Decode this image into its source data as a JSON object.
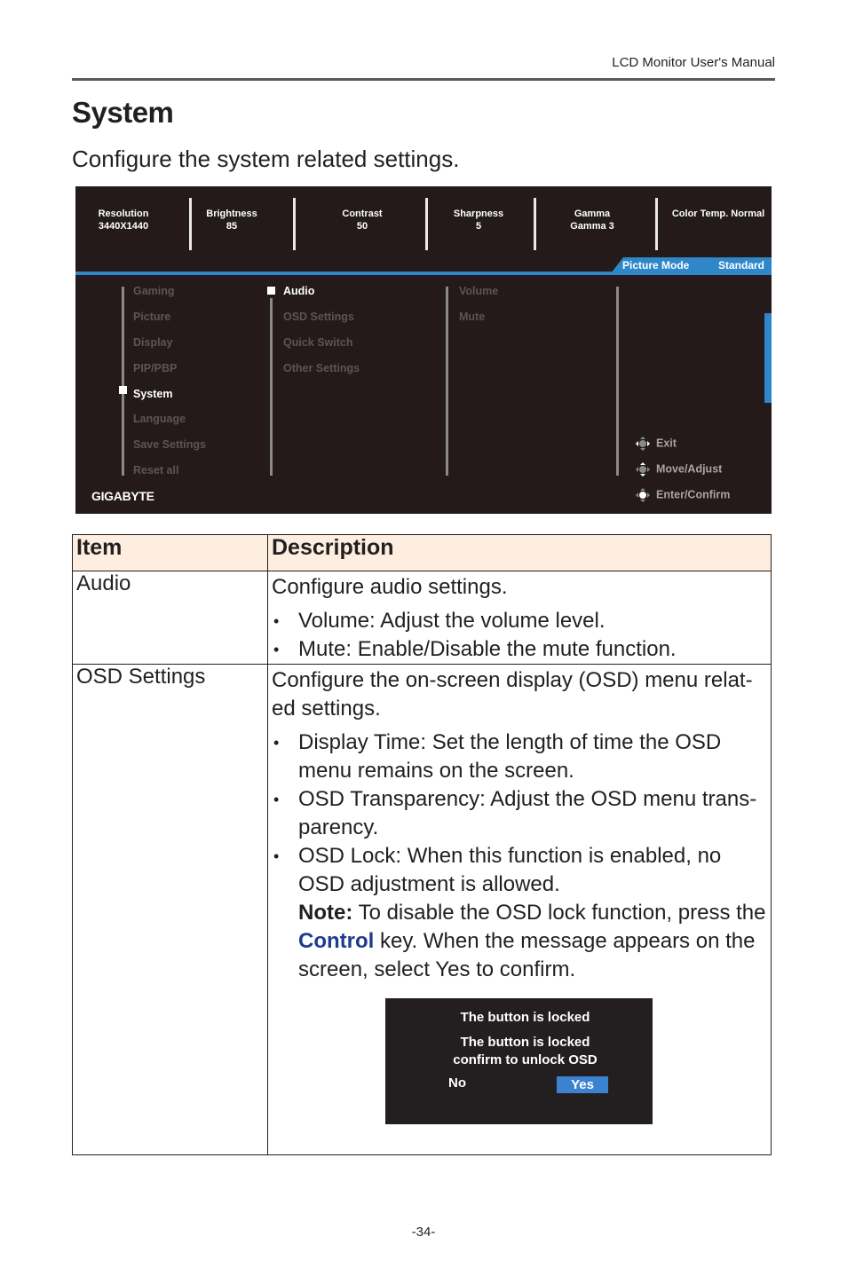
{
  "header": {
    "manual_title": "LCD Monitor User's Manual"
  },
  "page": {
    "title": "System",
    "subtitle": "Configure the system related settings.",
    "page_number": "-34-"
  },
  "osd": {
    "info_bar": [
      {
        "label": "Resolution",
        "value": "3440X1440"
      },
      {
        "label": "Brightness",
        "value": "85"
      },
      {
        "label": "Contrast",
        "value": "50"
      },
      {
        "label": "Sharpness",
        "value": "5"
      },
      {
        "label": "Gamma",
        "value": "Gamma 3"
      },
      {
        "label": "Color Temp. Normal",
        "value": ""
      }
    ],
    "picture_mode_label": "Picture Mode",
    "picture_mode_value": "Standard",
    "main_menu": [
      "Gaming",
      "Picture",
      "Display",
      "PIP/PBP",
      "System",
      "Language",
      "Save Settings",
      "Reset all"
    ],
    "main_selected": "System",
    "sub_menu": [
      "Audio",
      "OSD Settings",
      "Quick Switch",
      "Other Settings"
    ],
    "sub_selected": "Audio",
    "third_menu": [
      "Volume",
      "Mute"
    ],
    "hints": [
      {
        "icon": "joystick-exit-icon",
        "label": "Exit"
      },
      {
        "icon": "joystick-move-icon",
        "label": "Move/Adjust"
      },
      {
        "icon": "joystick-enter-icon",
        "label": "Enter/Confirm"
      }
    ],
    "logo": "GIGABYTE",
    "accent_color": "#2f86c8"
  },
  "table": {
    "headers": [
      "Item",
      "Description"
    ],
    "rows": [
      {
        "item": "Audio",
        "intro": "Configure audio settings.",
        "bullets": [
          "Volume: Adjust the volume level.",
          "Mute: Enable/Disable the mute function."
        ]
      },
      {
        "item": "OSD Settings",
        "intro": "Configure the on-screen display (OSD) menu relat-ed settings.",
        "bullets": [
          "Display Time: Set the length of time the OSD menu remains on the screen.",
          "OSD Transparency: Adjust the OSD menu trans-parency.",
          "OSD Lock: When this function is enabled, no OSD adjustment is allowed."
        ],
        "note_label": "Note:",
        "note_pre": " To disable the OSD lock function, press the ",
        "note_key": "Control",
        "note_post": " key. When the message appears on the screen, select Yes to confirm."
      }
    ]
  },
  "dialog": {
    "title": "The button is locked",
    "message_line1": "The button is locked",
    "message_line2": "confirm to unlock OSD",
    "no_label": "No",
    "yes_label": "Yes"
  }
}
